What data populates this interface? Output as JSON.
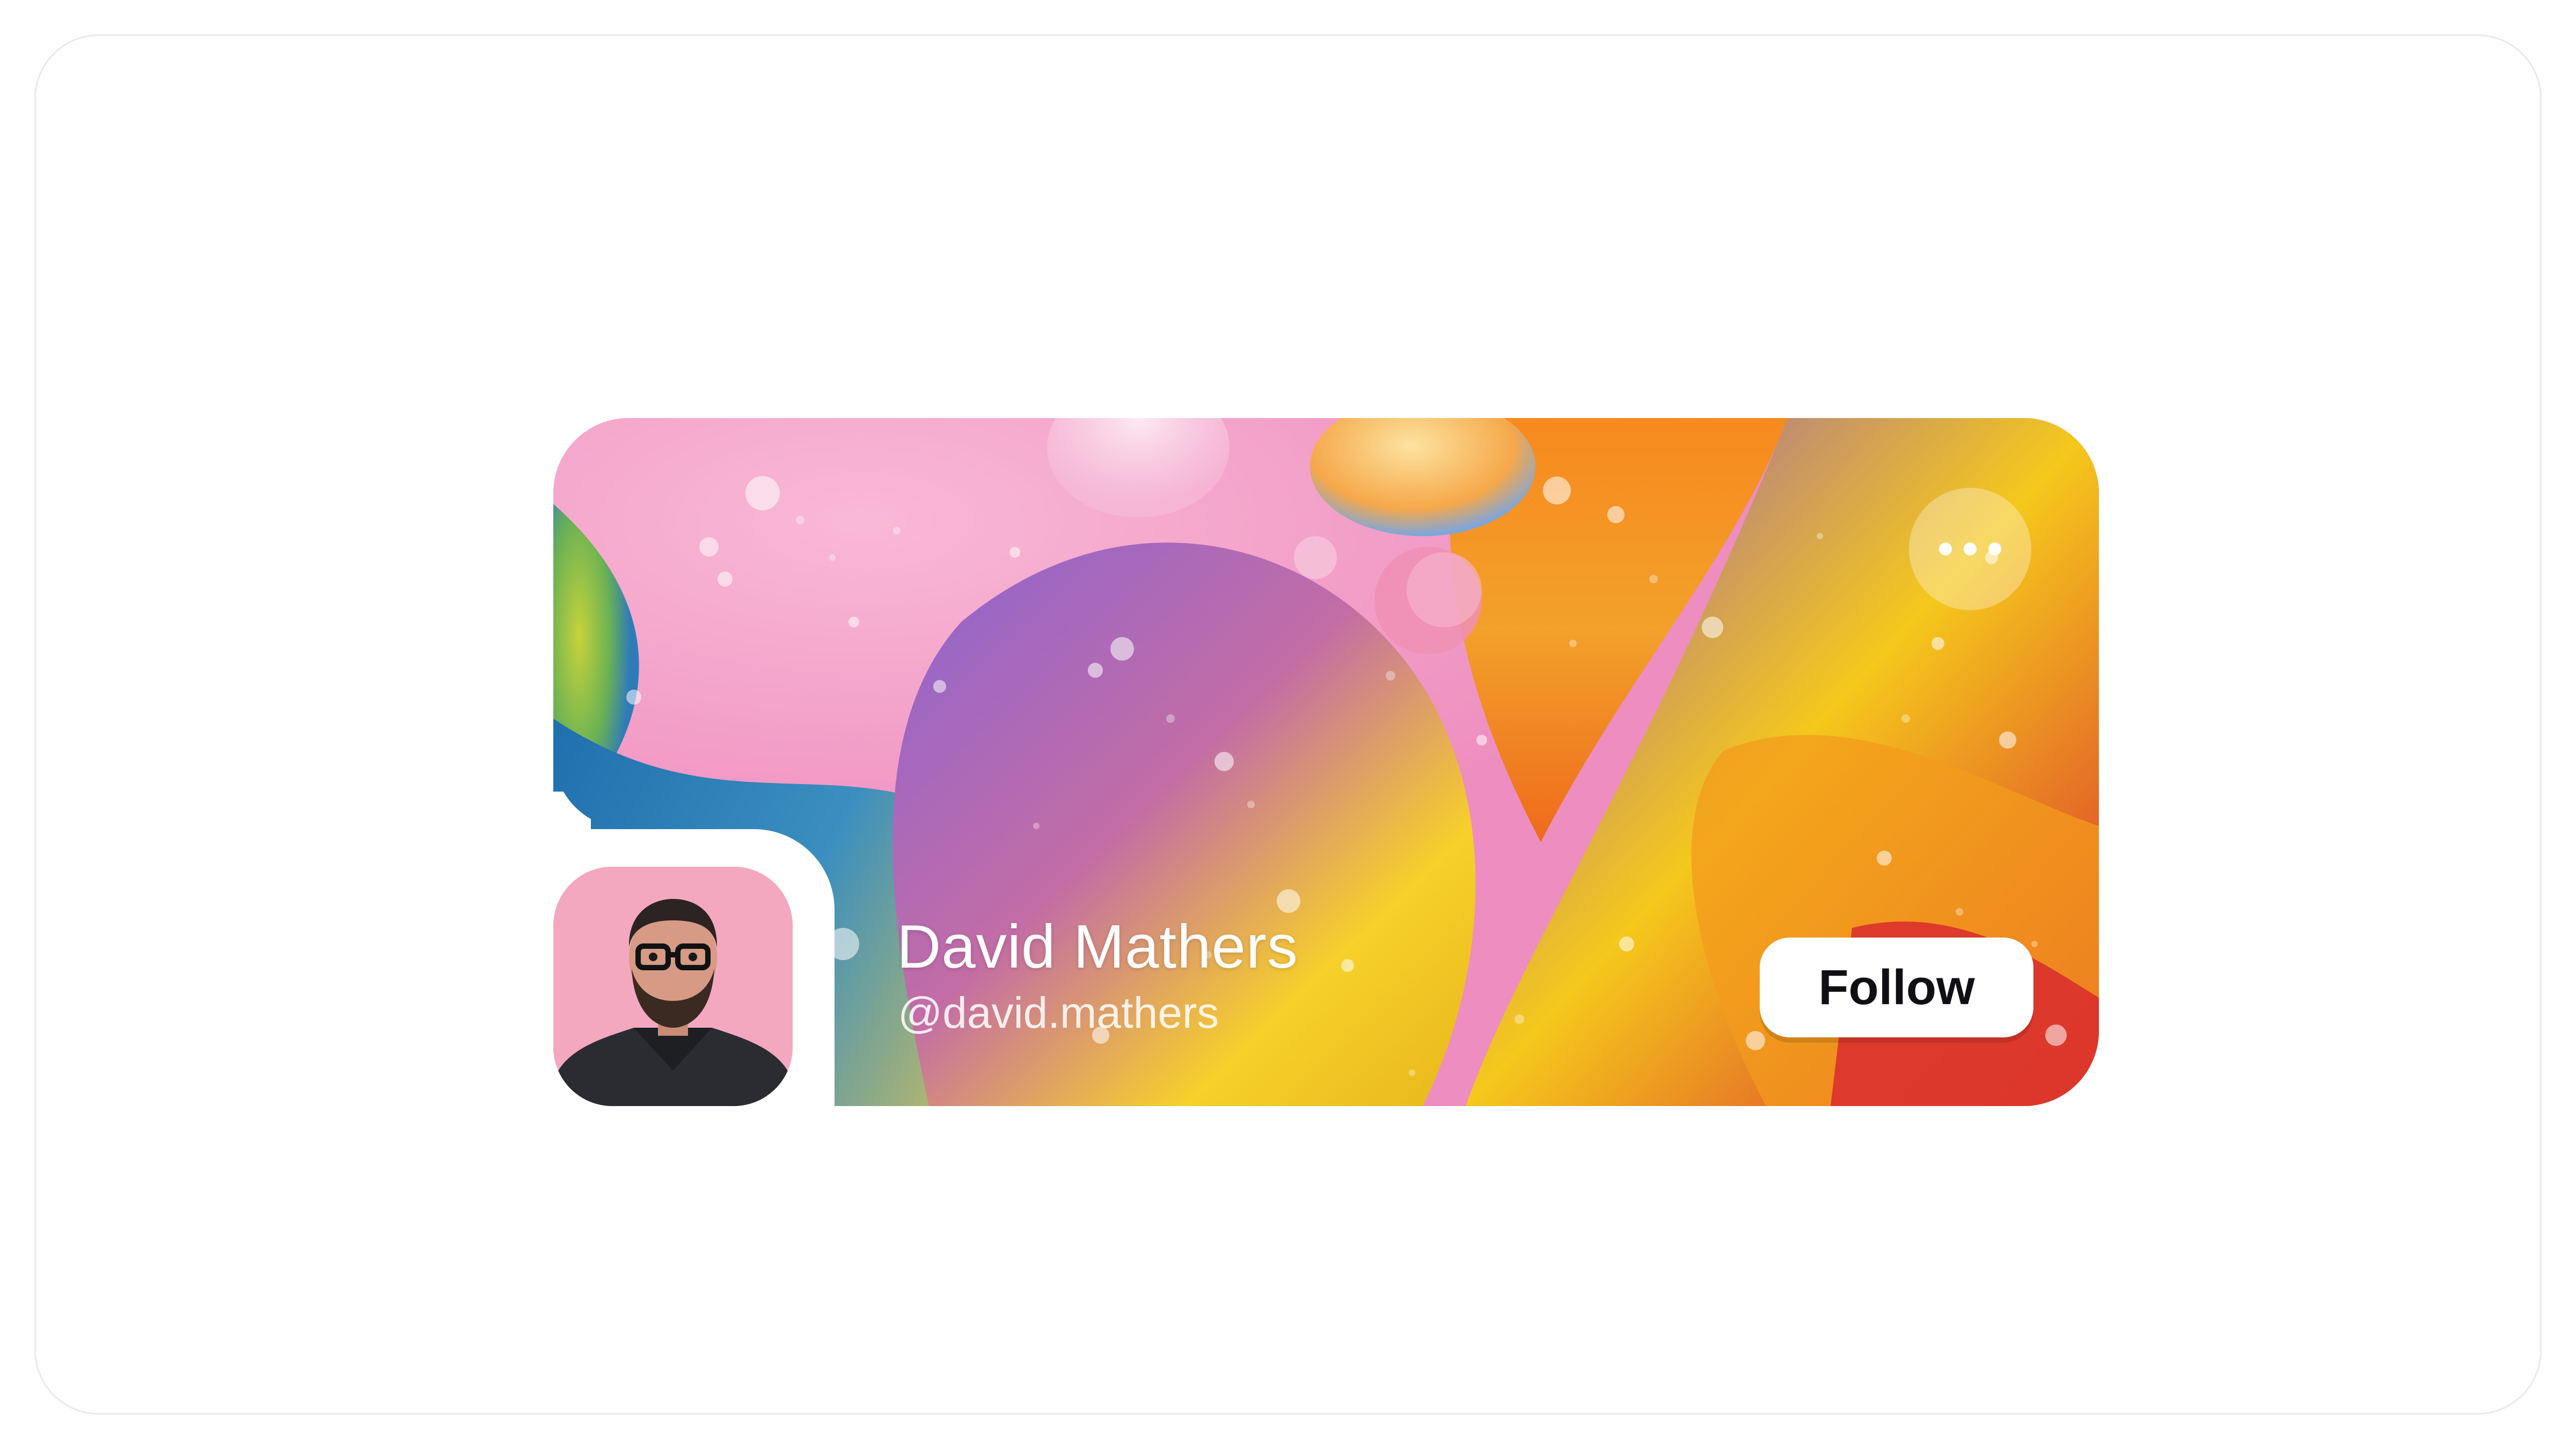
{
  "profile": {
    "name": "David Mathers",
    "handle": "@david.mathers",
    "follow_label": "Follow",
    "more_icon": "more-horizontal-icon",
    "avatar_background": "#f4a8bf"
  },
  "theme": {
    "page_background": "#ffffff",
    "frame_border": "#e9e9ec",
    "button_background": "#ffffff",
    "button_text": "#101014",
    "cover_colors": [
      "#f3a7c9",
      "#8a62c8",
      "#f2c21a",
      "#f47a1f",
      "#2c7fb5",
      "#d82e3a"
    ]
  }
}
